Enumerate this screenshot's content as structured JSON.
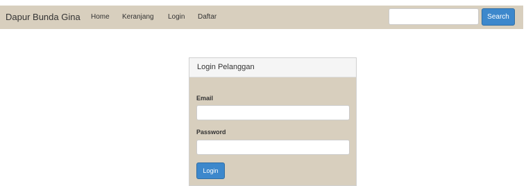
{
  "navbar": {
    "brand": "Dapur Bunda Gina",
    "links": [
      {
        "label": "Home"
      },
      {
        "label": "Keranjang"
      },
      {
        "label": "Login"
      },
      {
        "label": "Daftar"
      }
    ],
    "search": {
      "value": "",
      "placeholder": "",
      "button_label": "Search"
    },
    "background_color": "#d8cfbe"
  },
  "login_panel": {
    "title": "Login Pelanggan",
    "email_label": "Email",
    "email_value": "",
    "password_label": "Password",
    "password_value": "",
    "submit_label": "Login"
  },
  "colors": {
    "accent": "#3d88cc",
    "panel_background": "#d8cfbe",
    "panel_heading": "#f5f5f5"
  }
}
